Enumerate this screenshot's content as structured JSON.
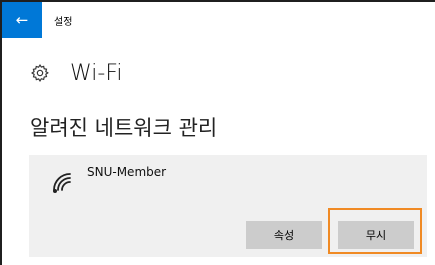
{
  "window": {
    "title": "설정",
    "back_icon": "back-arrow-icon",
    "accent_color": "#0078d7"
  },
  "header": {
    "icon": "gear-icon",
    "title": "Wi-Fi"
  },
  "section": {
    "title": "알려진 네트워크 관리"
  },
  "network": {
    "icon": "wifi-signal-icon",
    "name": "SNU-Member",
    "properties_label": "속성",
    "forget_label": "무시"
  },
  "highlight_color": "#f08a24"
}
